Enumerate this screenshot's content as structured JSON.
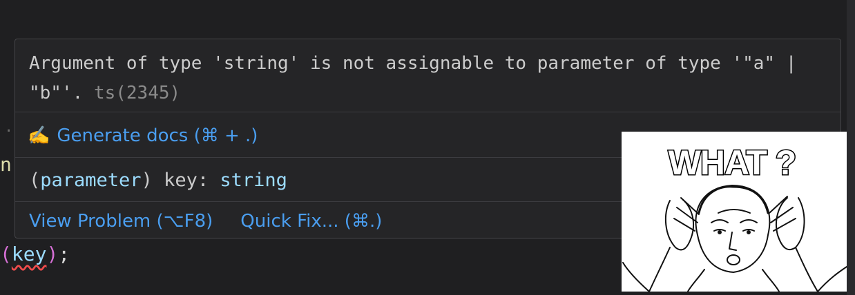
{
  "hover": {
    "message": "Argument of type 'string' is not assignable to parameter of type '\"a\" | \"b\"'.",
    "code": "ts(2345)",
    "generate_docs": {
      "icon": "writing-hand-icon",
      "icon_glyph": "✍️",
      "label": "Generate docs (⌘ + .)"
    },
    "signature": {
      "kind": "parameter",
      "name": "key",
      "type": "string"
    },
    "actions": {
      "view_problem": "View Problem (⌥F8)",
      "quick_fix": "Quick Fix... (⌘.)"
    }
  },
  "code": {
    "fragment_n": "n",
    "fragment_dot": "·",
    "open_paren": "(",
    "arg": "key",
    "close_paren": ")",
    "semicolon": ";"
  },
  "meme": {
    "caption": "WHAT ?"
  },
  "colors": {
    "background": "#1f1f21",
    "hover_bg": "#252527",
    "link": "#4a9ef0",
    "param": "#9cdcfe",
    "error_squiggle": "#f14c4c"
  }
}
